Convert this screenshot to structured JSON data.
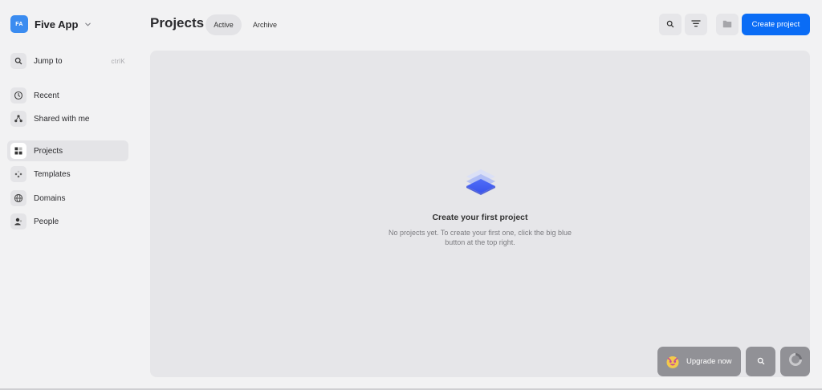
{
  "workspace": {
    "initials": "FA",
    "name": "Five App"
  },
  "sidebar": {
    "jump_to": {
      "label": "Jump to",
      "shortcut": "ctrlK"
    },
    "items": [
      {
        "label": "Recent",
        "icon": "clock-icon"
      },
      {
        "label": "Shared with me",
        "icon": "share-icon"
      },
      {
        "label": "Projects",
        "icon": "grid-icon",
        "active": true
      },
      {
        "label": "Templates",
        "icon": "templates-icon"
      },
      {
        "label": "Domains",
        "icon": "globe-icon"
      },
      {
        "label": "People",
        "icon": "person-icon"
      }
    ]
  },
  "header": {
    "title": "Projects",
    "tabs": [
      {
        "label": "Active",
        "active": true
      },
      {
        "label": "Archive",
        "active": false
      }
    ],
    "actions": {
      "search_icon": "search-icon",
      "filter_icon": "filter-icon",
      "folder_icon": "folder-icon"
    },
    "create_label": "Create project"
  },
  "empty_state": {
    "icon": "layers-icon",
    "title": "Create your first project",
    "description": "No projects yet. To create your first one, click the big blue button at the top right."
  },
  "floating": {
    "upgrade_label": "Upgrade now",
    "upgrade_icon": "smiley-icon",
    "search_icon": "search-icon",
    "loader_icon": "loader-icon"
  },
  "colors": {
    "accent": "#0a6cf5",
    "workspace_badge": "#3b8cf0",
    "floating_bg": "#919196"
  }
}
